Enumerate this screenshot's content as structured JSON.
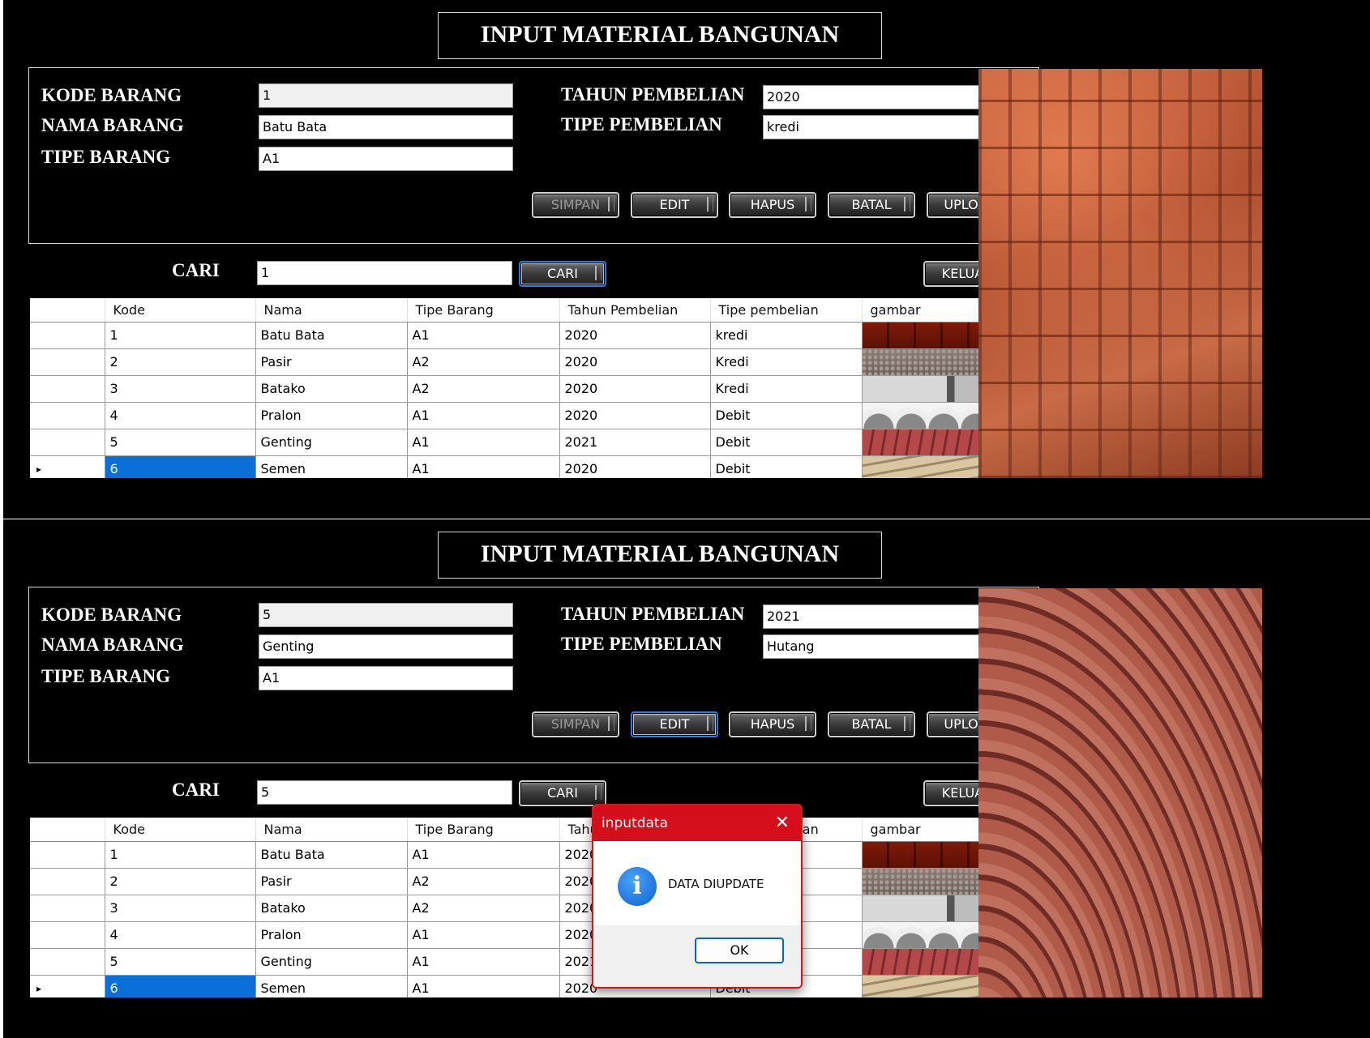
{
  "screen1": {
    "title": "INPUT MATERIAL BANGUNAN",
    "labels": {
      "kode": "KODE BARANG",
      "nama": "NAMA BARANG",
      "tipe": "TIPE BARANG",
      "tahun": "TAHUN PEMBELIAN",
      "tipe_pembelian": "TIPE PEMBELIAN",
      "cari": "CARI"
    },
    "fields": {
      "kode": "1",
      "nama": "Batu Bata",
      "tipe": "A1",
      "tahun": "2020",
      "tipe_pembelian": "kredi",
      "cari": "1"
    },
    "buttons": {
      "simpan": "SIMPAN",
      "edit": "EDIT",
      "hapus": "HAPUS",
      "batal": "BATAL",
      "upload": "UPLOAD",
      "cari": "CARI",
      "keluar": "KELUAR"
    },
    "photo": "bricks-photo"
  },
  "screen2": {
    "title": "INPUT MATERIAL BANGUNAN",
    "labels": {
      "kode": "KODE BARANG",
      "nama": "NAMA BARANG",
      "tipe": "TIPE BARANG",
      "tahun": "TAHUN PEMBELIAN",
      "tipe_pembelian": "TIPE PEMBELIAN",
      "cari": "CARI"
    },
    "fields": {
      "kode": "5",
      "nama": "Genting",
      "tipe": "A1",
      "tahun": "2021",
      "tipe_pembelian": "Hutang",
      "cari": "5"
    },
    "buttons": {
      "simpan": "SIMPAN",
      "edit": "EDIT",
      "hapus": "HAPUS",
      "batal": "BATAL",
      "upload": "UPLOAD",
      "cari": "CARI",
      "keluar": "KELUAR"
    },
    "photo": "roof-tiles-photo",
    "dialog": {
      "title": "inputdata",
      "message": "DATA DIUPDATE",
      "ok": "OK",
      "icon": "info-icon"
    }
  },
  "grid": {
    "columns": [
      "Kode",
      "Nama",
      "Tipe Barang",
      "Tahun Pembelian",
      "Tipe pembelian",
      "gambar"
    ],
    "rows": [
      {
        "kode": "1",
        "nama": "Batu Bata",
        "tipe": "A1",
        "tahun": "2020",
        "tipe_pembelian": "kredi",
        "gambar": "bata"
      },
      {
        "kode": "2",
        "nama": "Pasir",
        "tipe": "A2",
        "tahun": "2020",
        "tipe_pembelian": "Kredi",
        "gambar": "pasir"
      },
      {
        "kode": "3",
        "nama": "Batako",
        "tipe": "A2",
        "tahun": "2020",
        "tipe_pembelian": "Kredi",
        "gambar": "batako"
      },
      {
        "kode": "4",
        "nama": "Pralon",
        "tipe": "A1",
        "tahun": "2020",
        "tipe_pembelian": "Debit",
        "gambar": "pralon"
      },
      {
        "kode": "5",
        "nama": "Genting",
        "tipe": "A1",
        "tahun": "2021",
        "tipe_pembelian": "Debit",
        "gambar": "genting"
      },
      {
        "kode": "6",
        "nama": "Semen",
        "tipe": "A1",
        "tahun": "2020",
        "tipe_pembelian": "Debit",
        "gambar": "semen"
      }
    ],
    "current_row_marker": "▸",
    "selected_color": "#0a6fd6"
  },
  "colors": {
    "background": "#000000",
    "dialog_title": "#d40e1b",
    "info_icon": "#0a64c8"
  }
}
